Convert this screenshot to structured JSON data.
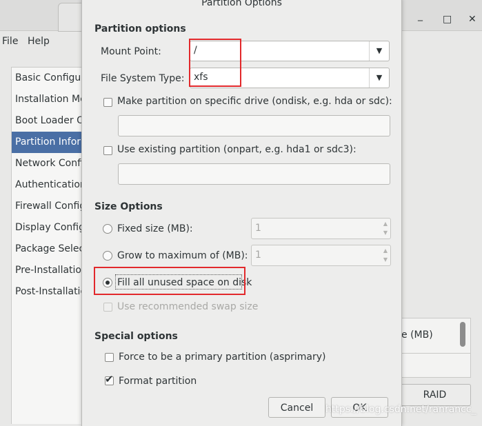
{
  "background": {
    "menu": [
      "File",
      "Help"
    ],
    "window_controls": [
      "_",
      "□",
      "✕"
    ],
    "sidebar_items": [
      {
        "label": "Basic Configuration",
        "active": false
      },
      {
        "label": "Installation Method",
        "active": false
      },
      {
        "label": "Boot Loader Options",
        "active": false
      },
      {
        "label": "Partition Information",
        "active": true
      },
      {
        "label": "Network Configuration",
        "active": false
      },
      {
        "label": "Authentication",
        "active": false
      },
      {
        "label": "Firewall Configuration",
        "active": false
      },
      {
        "label": "Display Configuration",
        "active": false
      },
      {
        "label": "Package Selection",
        "active": false
      },
      {
        "label": "Pre-Installation Script",
        "active": false
      },
      {
        "label": "Post-Installation Script",
        "active": false
      }
    ],
    "size_column_fragment": "e (MB)",
    "raid_button": "RAID",
    "active_color": "#4a6fa5"
  },
  "dialog": {
    "title": "Partition Options",
    "partition_options_heading": "Partition options",
    "mount_point_label": "Mount Point:",
    "mount_point_value": "/",
    "fs_type_label": "File System Type:",
    "fs_type_value": "xfs",
    "specific_drive_label": "Make partition on specific drive (ondisk, e.g. hda or sdc):",
    "specific_drive_value": "",
    "existing_partition_label": "Use existing partition (onpart, e.g. hda1 or sdc3):",
    "existing_partition_value": "",
    "size_options_heading": "Size Options",
    "fixed_size_label": "Fixed size (MB):",
    "fixed_size_value": "1",
    "grow_max_label": "Grow to maximum of (MB):",
    "grow_max_value": "1",
    "fill_disk_label": "Fill all unused space on disk",
    "recommended_swap_label": "Use recommended swap size",
    "special_options_heading": "Special options",
    "primary_partition_label": "Force to be a primary partition (asprimary)",
    "format_partition_label": "Format partition",
    "cancel_label": "Cancel",
    "ok_label": "OK",
    "size_mode": "fill"
  },
  "watermark": "https://blog.csdn.net/ranrancc_",
  "highlight_color": "#e2282b"
}
